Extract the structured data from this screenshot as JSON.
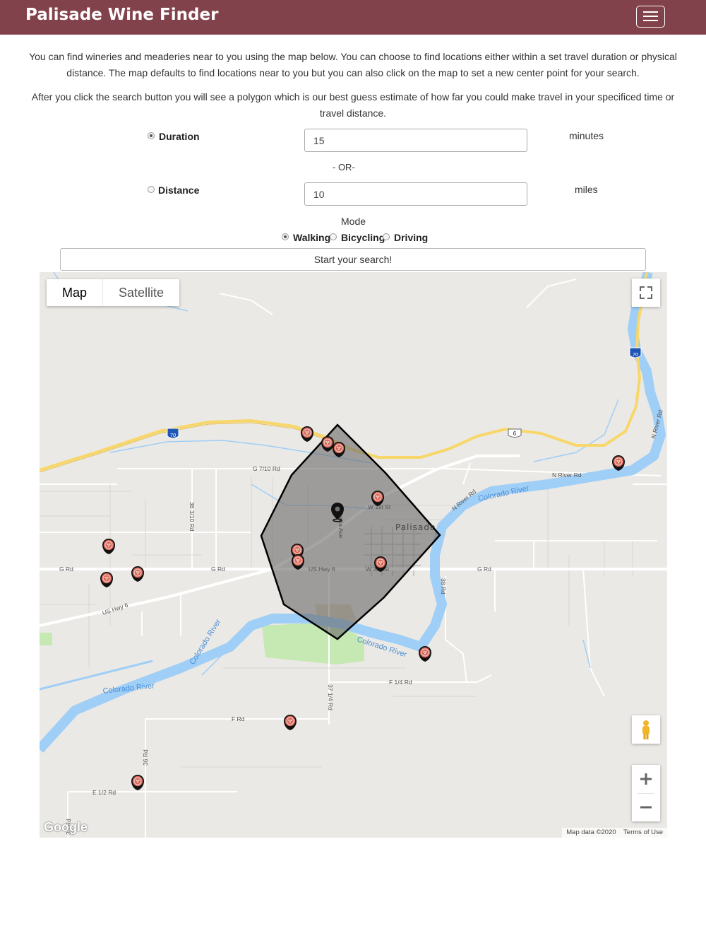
{
  "navbar": {
    "brand": "Palisade Wine Finder"
  },
  "intro": {
    "paragraph1": "You can find wineries and meaderies near to you using the map below. You can choose to find locations either within a set travel duration or physical distance. The map defaults to find locations near to you but you can also click on the map to set a new center point for your search.",
    "paragraph2": "After you click the search button you will see a polygon which is our best guess estimate of how far you could make travel in your specificed time or travel distance."
  },
  "form": {
    "duration_label": "Duration",
    "duration_value": "15",
    "duration_unit": "minutes",
    "or_label": "- OR-",
    "distance_label": "Distance",
    "distance_value": "10",
    "distance_unit": "miles",
    "mode_label": "Mode",
    "modes": [
      "Walking",
      "Bicycling",
      "Driving"
    ],
    "selected_mode": "Walking",
    "selected_search": "Duration",
    "search_button": "Start your search!"
  },
  "map": {
    "type_map": "Map",
    "type_satellite": "Satellite",
    "town_label": "Palisade",
    "road_labels": {
      "g_7_10": "G 7/10 Rd",
      "n_river": "N River Rd",
      "n_river_diag": "N River Rd",
      "n_river_top": "N River Rd",
      "w_1st": "W 1st St",
      "w_3rd": "W 3rd St",
      "g_rd_left": "G Rd",
      "g_rd_mid": "G Rd",
      "g_rd_right": "G Rd",
      "us_hwy_6": "US Hwy 6",
      "us_hwy_6_diag": "US Hwy 6",
      "elberta": "Elberta Ave",
      "rd_36_3_10": "36 3/10 Rd",
      "rd_38": "38 Rd",
      "rd_37_1_4": "37 1/4 Rd",
      "f_1_4": "F 1/4 Rd",
      "f_rd": "F Rd",
      "rd_36": "36 Rd",
      "e_1_2": "E 1/2 Rd",
      "rd_35": "35 Rd",
      "colorado_river_1": "Colorado River",
      "colorado_river_2": "Colorado River",
      "colorado_river_3": "Colorado River",
      "colorado_river_4": "Colorado River"
    },
    "shields": {
      "i70_left": "70",
      "i70_right": "70",
      "us6": "6"
    },
    "attribution": "Map data ©2020",
    "terms": "Terms of Use",
    "logo": "Google",
    "colors": {
      "water": "#9fcef7",
      "park": "#c6e8b3",
      "polygon": "#777777",
      "marker": "#c95a4f",
      "interstate": "#f7d76a"
    }
  }
}
